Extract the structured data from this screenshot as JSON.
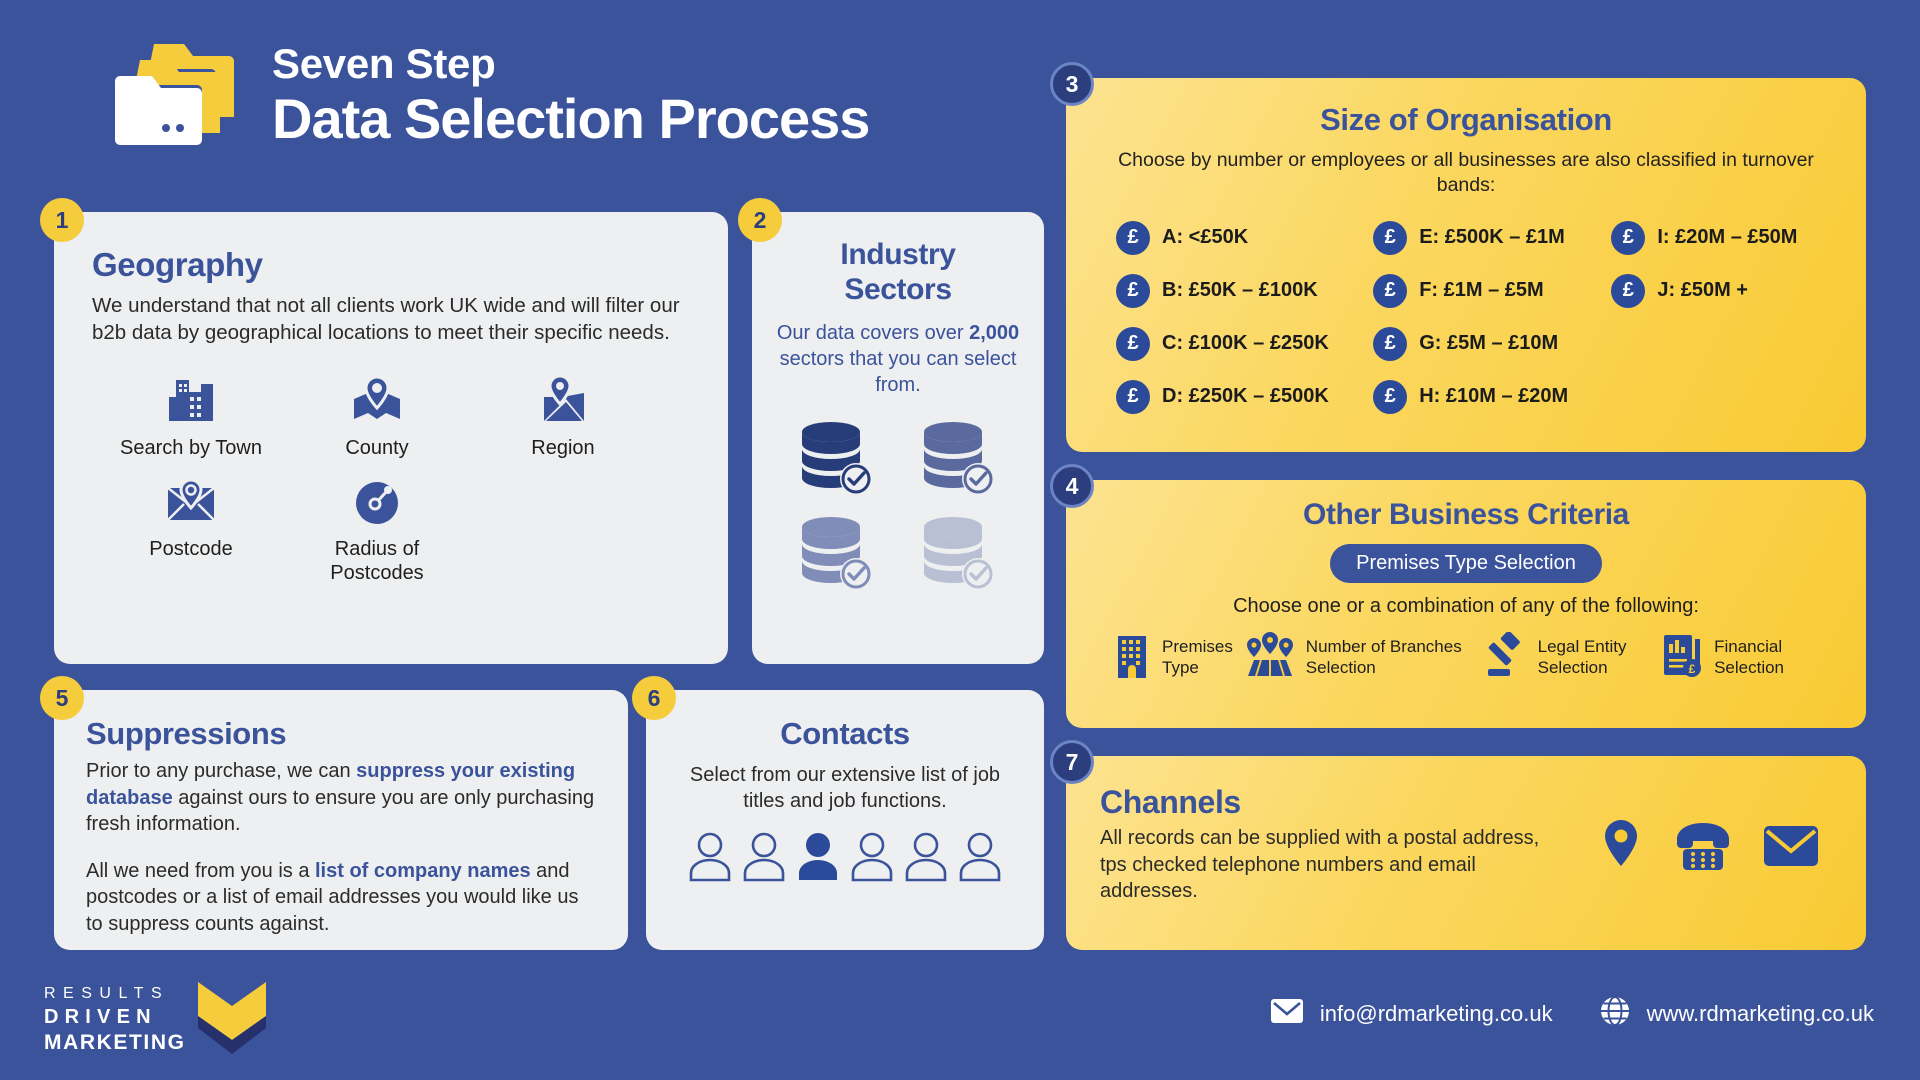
{
  "header": {
    "title_small": "Seven Step",
    "title_large": "Data Selection Process",
    "icon": "folders-icon"
  },
  "colors": {
    "background": "#3a539b",
    "card_grey": "#eeeff0",
    "yellow_light": "#fce391",
    "yellow_dark": "#f8ca33",
    "navy": "#2c3e7e",
    "accent_blue": "#3a539b",
    "badge_yellow": "#f5cc3c"
  },
  "steps": {
    "geography": {
      "number": "1",
      "title": "Geography",
      "body": "We understand that not all clients work UK wide and will filter our b2b data by geographical locations to meet their specific needs.",
      "items": [
        {
          "label": "Search by Town",
          "icon": "city-buildings-icon"
        },
        {
          "label": "County",
          "icon": "map-pin-county-icon"
        },
        {
          "label": "Region",
          "icon": "map-region-pin-icon"
        },
        {
          "label": "Postcode",
          "icon": "envelope-pin-icon"
        },
        {
          "label": "Radius of Postcodes",
          "icon": "radius-circle-icon"
        }
      ]
    },
    "industry": {
      "number": "2",
      "title_line1": "Industry",
      "title_line2": "Sectors",
      "sub_before": "Our data covers over ",
      "sub_highlight": "2,000",
      "sub_after": " sectors that you can select from.",
      "database_icons": [
        "database-check-icon",
        "database-check-icon",
        "database-check-icon",
        "database-check-icon"
      ]
    },
    "size": {
      "number": "3",
      "title": "Size of Organisation",
      "sub": "Choose by number or employees or all businesses are also classified in turnover bands:",
      "band_icon": "pound-sterling-icon",
      "columns": [
        [
          {
            "label": "A: <£50K"
          },
          {
            "label": "B: £50K – £100K"
          },
          {
            "label": "C: £100K – £250K"
          },
          {
            "label": "D: £250K – £500K"
          }
        ],
        [
          {
            "label": "E: £500K – £1M"
          },
          {
            "label": "F: £1M – £5M"
          },
          {
            "label": "G: £5M – £10M"
          },
          {
            "label": "H: £10M – £20M"
          }
        ],
        [
          {
            "label": "I: £20M – £50M"
          },
          {
            "label": "J: £50M +"
          }
        ]
      ]
    },
    "criteria": {
      "number": "4",
      "title": "Other Business Criteria",
      "pill": "Premises Type Selection",
      "choose": "Choose one or a combination of any of the following:",
      "items": [
        {
          "label": "Premises Type",
          "icon": "office-building-icon"
        },
        {
          "label": "Number of Branches Selection",
          "icon": "branch-pins-icon"
        },
        {
          "label": "Legal Entity Selection",
          "icon": "gavel-icon"
        },
        {
          "label": "Financial Selection",
          "icon": "financial-document-icon"
        }
      ]
    },
    "suppressions": {
      "number": "5",
      "title": "Suppressions",
      "para1_a": "Prior to any purchase, we can ",
      "para1_hl": "suppress your existing database",
      "para1_b": " against ours to ensure you are only purchasing fresh information.",
      "para2_a": "All we need from you is a ",
      "para2_hl": "list of company names",
      "para2_b": " and postcodes or a list of email addresses you would like us to suppress counts against."
    },
    "contacts": {
      "number": "6",
      "title": "Contacts",
      "sub": "Select from our extensive list of job titles and job functions.",
      "people_count": 6,
      "highlighted_index": 2,
      "icon": "person-icon"
    },
    "channels": {
      "number": "7",
      "title": "Channels",
      "body": "All records can be supplied with a postal address, tps checked telephone numbers and email addresses.",
      "icons": [
        "location-pin-icon",
        "telephone-icon",
        "envelope-icon"
      ]
    }
  },
  "footer": {
    "logo": {
      "line1": "RESULTS",
      "line2": "DRIVEN",
      "line3": "MARKETING",
      "mark": "chevron-logo-mark"
    },
    "email": "info@rdmarketing.co.uk",
    "website": "www.rdmarketing.co.uk",
    "email_icon": "envelope-icon",
    "globe_icon": "globe-icon"
  }
}
